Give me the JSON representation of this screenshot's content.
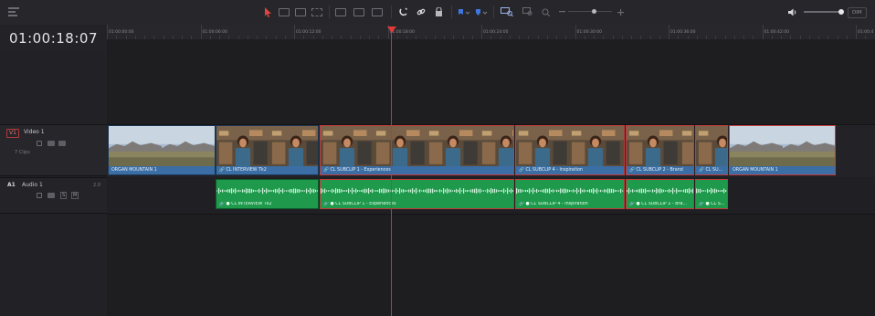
{
  "toolbar": {
    "left_icon": "timeline-view-icon",
    "tools": [
      "pointer-icon",
      "trim-icon",
      "dynamic-trim-icon",
      "blade-icon",
      "insert-icon",
      "overwrite-icon",
      "replace-icon",
      "snapping-icon",
      "linked-selection-icon",
      "position-lock-icon",
      "flag-icon",
      "marker-icon",
      "detail-zoom-icon",
      "zoom-full-icon",
      "custom-zoom-icon",
      "zoom-slider",
      "speaker-icon",
      "volume-slider"
    ],
    "dim_label": "DIM"
  },
  "timecode": "01:00:18:07",
  "ruler": {
    "labels": [
      "01:00:00:00",
      "01:00:06:00",
      "01:00:12:00",
      "01:00:18:00",
      "01:00:24:00",
      "01:00:30:00",
      "01:00:36:00",
      "01:00:42:00",
      "01:00:4"
    ]
  },
  "tracks": {
    "video": {
      "badge": "V1",
      "name": "Video 1",
      "clip_count": "7 Clips"
    },
    "audio": {
      "badge": "A1",
      "name": "Audio 1",
      "level": "2.0",
      "solo": "S",
      "mute": "M"
    }
  },
  "video_clips": [
    {
      "label": "ORGAN MOUNTAIN 1",
      "kind": "landscape",
      "selected": false
    },
    {
      "label": "CL INTERVIEW Tk2",
      "kind": "interview",
      "selected": false
    },
    {
      "label": "CL SUBCLIP 1 - Experiences",
      "kind": "interview",
      "selected": true
    },
    {
      "label": "CL SUBCLIP 4 - Inspiration",
      "kind": "interview",
      "selected": true
    },
    {
      "label": "CL SUBCLIP 2 - Brand",
      "kind": "interview",
      "selected": true
    },
    {
      "label": "CL SU...",
      "kind": "interview",
      "selected": true
    },
    {
      "label": "ORGAN MOUNTAIN 1",
      "kind": "landscape",
      "selected": true
    }
  ],
  "audio_clips": [
    {
      "label": "● CL INTERVIEW Tk2",
      "selected": false
    },
    {
      "label": "● CL SUBCLIP 1 - Experiences",
      "selected": true
    },
    {
      "label": "● CL SUBCLIP 4 - Inspiration",
      "selected": true
    },
    {
      "label": "● CL SUBCLIP 2 - Bra...",
      "selected": true
    },
    {
      "label": "● CL S...",
      "selected": true
    }
  ],
  "colors": {
    "video_clip": "#3a6ea5",
    "audio_clip": "#1f9a4c",
    "playhead": "#d63030",
    "selection": "#c23b3b"
  }
}
